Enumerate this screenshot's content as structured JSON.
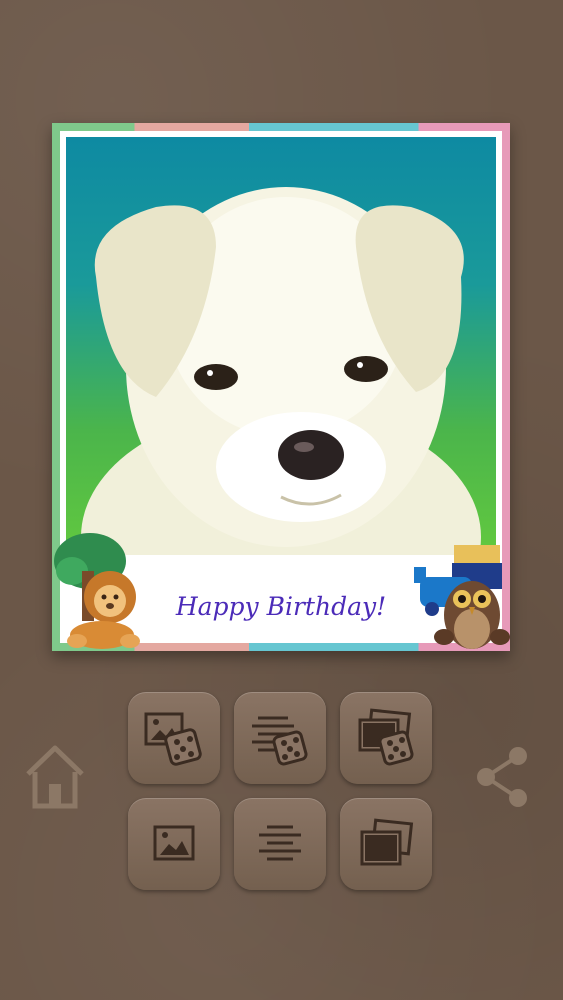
{
  "card": {
    "caption": "Happy Birthday!",
    "border_colors": [
      "#7fc98b",
      "#e4a8a0",
      "#66c6d1",
      "#e79ab9"
    ],
    "caption_color": "#4b2bb8"
  },
  "stickers": {
    "left": "lion-with-tree-sticker",
    "right": "owl-with-toy-train-sticker"
  },
  "photo": {
    "subject": "white-puppy"
  },
  "toolbar": {
    "buttons": [
      {
        "name": "random-photo-button",
        "icon": "image-dice-icon"
      },
      {
        "name": "random-text-button",
        "icon": "align-dice-icon"
      },
      {
        "name": "random-frame-button",
        "icon": "frames-dice-icon"
      },
      {
        "name": "choose-photo-button",
        "icon": "image-icon"
      },
      {
        "name": "choose-text-button",
        "icon": "align-center-icon"
      },
      {
        "name": "choose-frame-button",
        "icon": "frames-icon"
      }
    ]
  },
  "nav": {
    "home": "home-icon",
    "share": "share-icon"
  }
}
